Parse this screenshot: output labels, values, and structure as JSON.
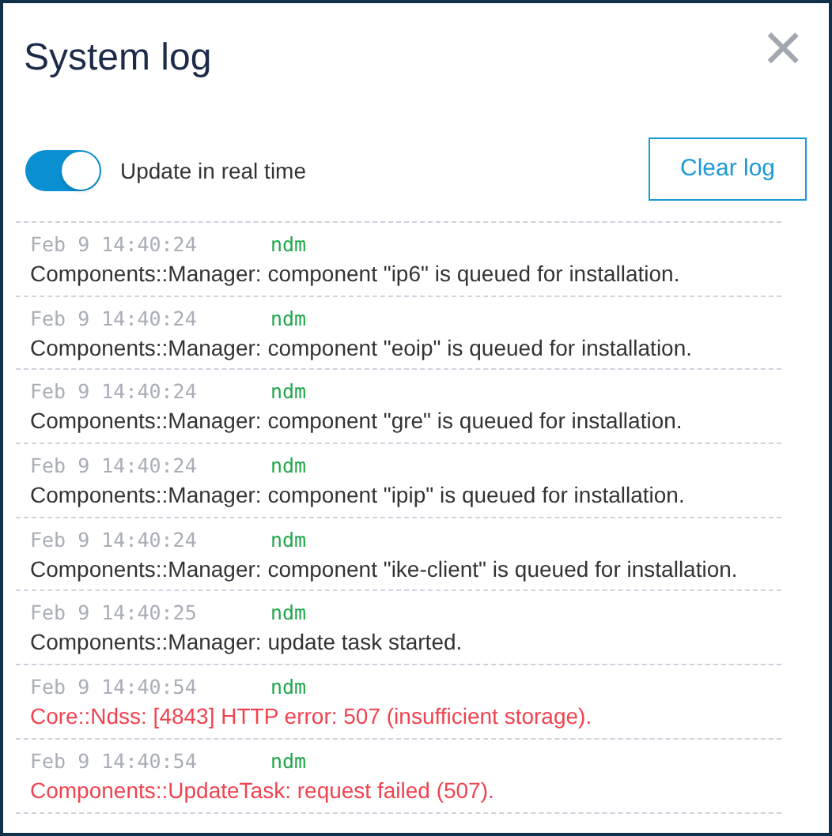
{
  "dialog": {
    "title": "System log",
    "close": "×"
  },
  "realtime_toggle": {
    "label": "Update in real time",
    "on": true
  },
  "clear_button": "Clear log",
  "entries": [
    {
      "time": "Feb 9 14:40:24",
      "source": "ndm",
      "message": "Components::Manager: component \"ip6\" is queued for installation.",
      "kind": "info"
    },
    {
      "time": "Feb 9 14:40:24",
      "source": "ndm",
      "message": "Components::Manager: component \"eoip\" is queued for installation.",
      "kind": "info"
    },
    {
      "time": "Feb 9 14:40:24",
      "source": "ndm",
      "message": "Components::Manager: component \"gre\" is queued for installation.",
      "kind": "info"
    },
    {
      "time": "Feb 9 14:40:24",
      "source": "ndm",
      "message": "Components::Manager: component \"ipip\" is queued for installation.",
      "kind": "info"
    },
    {
      "time": "Feb 9 14:40:24",
      "source": "ndm",
      "message": "Components::Manager: component \"ike-client\" is queued for installation.",
      "kind": "info"
    },
    {
      "time": "Feb 9 14:40:25",
      "source": "ndm",
      "message": "Components::Manager: update task started.",
      "kind": "info"
    },
    {
      "time": "Feb 9 14:40:54",
      "source": "ndm",
      "message": "Core::Ndss: [4843] HTTP error: 507 (insufficient storage).",
      "kind": "error"
    },
    {
      "time": "Feb 9 14:40:54",
      "source": "ndm",
      "message": "Components::UpdateTask: request failed (507).",
      "kind": "error"
    }
  ]
}
